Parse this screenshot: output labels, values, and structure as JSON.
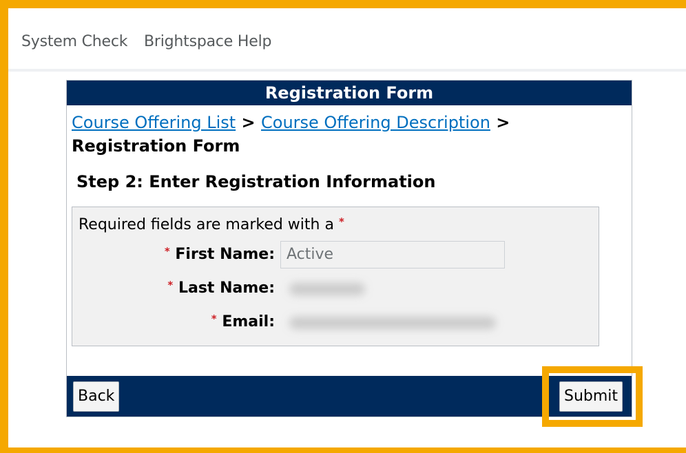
{
  "topnav": {
    "links": [
      "System Check",
      "Brightspace Help"
    ]
  },
  "form": {
    "title": "Registration Form",
    "breadcrumb": {
      "link1": "Course Offering List",
      "link2": "Course Offering Description",
      "separator": ">",
      "current": "Registration Form"
    },
    "step": "Step 2: Enter Registration Information",
    "required_note": "Required fields are marked with a",
    "required_marker": "*",
    "fields": {
      "first_name": {
        "label": "First Name:",
        "value": "Active"
      },
      "last_name": {
        "label": "Last Name:"
      },
      "email": {
        "label": "Email:"
      }
    },
    "buttons": {
      "back": "Back",
      "submit": "Submit"
    }
  },
  "colors": {
    "accent_highlight": "#f5a800",
    "header_bar": "#002a5c",
    "link": "#006fbf",
    "required": "#cd2026"
  }
}
